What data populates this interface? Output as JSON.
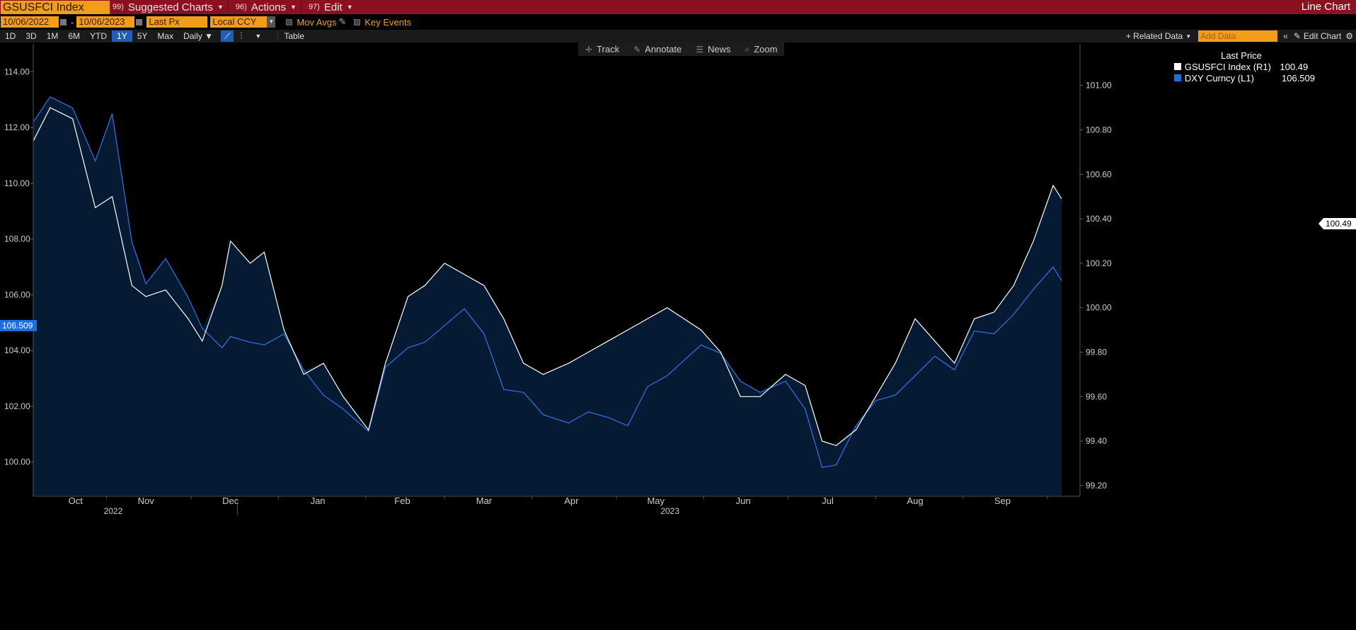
{
  "titlebar": {
    "ticker": "GSUSFCI Index",
    "menus": [
      {
        "num": "99)",
        "label": "Suggested Charts"
      },
      {
        "num": "96)",
        "label": "Actions"
      },
      {
        "num": "97)",
        "label": "Edit"
      }
    ],
    "chart_kind": "Line Chart"
  },
  "controls": {
    "start_date": "10/06/2022",
    "end_date": "10/06/2023",
    "field": "Last Px",
    "currency": "Local CCY",
    "mov_avgs": "Mov Avgs",
    "key_events": "Key Events"
  },
  "periods": [
    "1D",
    "3D",
    "1M",
    "6M",
    "YTD",
    "1Y",
    "5Y",
    "Max"
  ],
  "active_period": "1Y",
  "frequency": "Daily ▼",
  "table_label": "Table",
  "toolbar_right": {
    "related": "+ Related Data",
    "add_data_placeholder": "Add Data",
    "edit_chart": "Edit Chart"
  },
  "chart_tools": [
    "Track",
    "Annotate",
    "News",
    "Zoom"
  ],
  "legend": {
    "title": "Last Price",
    "items": [
      {
        "name": "GSUSFCI Index  (R1)",
        "value": "100.49",
        "color": "#ffffff"
      },
      {
        "name": "DXY Curncy  (L1)",
        "value": "106.509",
        "color": "#1b6ee0"
      }
    ]
  },
  "last_tags": {
    "left": "106.509",
    "right": "100.49"
  },
  "colors": {
    "fill": "#061a33",
    "dxy": "#2f74e8",
    "gsusfci": "#ffffff",
    "background": "#000000"
  },
  "chart_data": {
    "type": "line",
    "x_start": "2022-10-06",
    "x_end": "2023-10-06",
    "month_labels": [
      "Oct",
      "Nov",
      "Dec",
      "Jan",
      "Feb",
      "Mar",
      "Apr",
      "May",
      "Jun",
      "Jul",
      "Aug",
      "Sep"
    ],
    "year_labels": [
      "2022",
      "2023"
    ],
    "left_axis": {
      "series": "DXY Curncy",
      "ylim": [
        98.8,
        115.0
      ],
      "ticks": [
        "114.00",
        "112.00",
        "110.00",
        "108.00",
        "106.00",
        "104.00",
        "102.00",
        "100.00"
      ]
    },
    "right_axis": {
      "series": "GSUSFCI Index",
      "ylim": [
        99.155,
        101.187
      ],
      "ticks": [
        "101.00",
        "100.80",
        "100.60",
        "100.40",
        "100.20",
        "100.00",
        "99.80",
        "99.60",
        "99.40",
        "99.20"
      ]
    },
    "series": [
      {
        "name": "DXY Curncy (L1)",
        "axis": "left",
        "points": [
          [
            "2022-10-06",
            112.2
          ],
          [
            "2022-10-12",
            113.1
          ],
          [
            "2022-10-20",
            112.7
          ],
          [
            "2022-10-28",
            110.8
          ],
          [
            "2022-11-03",
            112.5
          ],
          [
            "2022-11-10",
            107.9
          ],
          [
            "2022-11-15",
            106.4
          ],
          [
            "2022-11-22",
            107.3
          ],
          [
            "2022-11-30",
            105.9
          ],
          [
            "2022-12-05",
            104.8
          ],
          [
            "2022-12-12",
            104.1
          ],
          [
            "2022-12-15",
            104.5
          ],
          [
            "2022-12-22",
            104.3
          ],
          [
            "2022-12-27",
            104.2
          ],
          [
            "2023-01-03",
            104.6
          ],
          [
            "2023-01-10",
            103.3
          ],
          [
            "2023-01-17",
            102.4
          ],
          [
            "2023-01-24",
            101.9
          ],
          [
            "2023-02-02",
            101.1
          ],
          [
            "2023-02-08",
            103.4
          ],
          [
            "2023-02-16",
            104.1
          ],
          [
            "2023-02-22",
            104.3
          ],
          [
            "2023-03-01",
            104.9
          ],
          [
            "2023-03-08",
            105.5
          ],
          [
            "2023-03-15",
            104.6
          ],
          [
            "2023-03-22",
            102.6
          ],
          [
            "2023-03-29",
            102.5
          ],
          [
            "2023-04-05",
            101.7
          ],
          [
            "2023-04-14",
            101.4
          ],
          [
            "2023-04-21",
            101.8
          ],
          [
            "2023-04-28",
            101.6
          ],
          [
            "2023-05-05",
            101.3
          ],
          [
            "2023-05-12",
            102.7
          ],
          [
            "2023-05-19",
            103.1
          ],
          [
            "2023-05-31",
            104.2
          ],
          [
            "2023-06-07",
            103.9
          ],
          [
            "2023-06-14",
            102.9
          ],
          [
            "2023-06-21",
            102.5
          ],
          [
            "2023-06-30",
            102.9
          ],
          [
            "2023-07-07",
            101.9
          ],
          [
            "2023-07-13",
            99.8
          ],
          [
            "2023-07-18",
            99.9
          ],
          [
            "2023-07-25",
            101.3
          ],
          [
            "2023-08-01",
            102.2
          ],
          [
            "2023-08-08",
            102.4
          ],
          [
            "2023-08-15",
            103.1
          ],
          [
            "2023-08-22",
            103.8
          ],
          [
            "2023-08-29",
            103.3
          ],
          [
            "2023-09-05",
            104.7
          ],
          [
            "2023-09-12",
            104.6
          ],
          [
            "2023-09-19",
            105.3
          ],
          [
            "2023-09-26",
            106.2
          ],
          [
            "2023-10-03",
            107.0
          ],
          [
            "2023-10-06",
            106.509
          ]
        ]
      },
      {
        "name": "GSUSFCI Index (R1)",
        "axis": "right",
        "points": [
          [
            "2022-10-06",
            100.75
          ],
          [
            "2022-10-12",
            100.9
          ],
          [
            "2022-10-20",
            100.85
          ],
          [
            "2022-10-28",
            100.45
          ],
          [
            "2022-11-03",
            100.5
          ],
          [
            "2022-11-10",
            100.1
          ],
          [
            "2022-11-15",
            100.05
          ],
          [
            "2022-11-22",
            100.08
          ],
          [
            "2022-11-30",
            99.95
          ],
          [
            "2022-12-05",
            99.85
          ],
          [
            "2022-12-12",
            100.1
          ],
          [
            "2022-12-15",
            100.3
          ],
          [
            "2022-12-22",
            100.2
          ],
          [
            "2022-12-27",
            100.25
          ],
          [
            "2023-01-03",
            99.9
          ],
          [
            "2023-01-10",
            99.7
          ],
          [
            "2023-01-17",
            99.75
          ],
          [
            "2023-01-24",
            99.6
          ],
          [
            "2023-02-02",
            99.45
          ],
          [
            "2023-02-08",
            99.75
          ],
          [
            "2023-02-16",
            100.05
          ],
          [
            "2023-02-22",
            100.1
          ],
          [
            "2023-03-01",
            100.2
          ],
          [
            "2023-03-08",
            100.15
          ],
          [
            "2023-03-15",
            100.1
          ],
          [
            "2023-03-22",
            99.95
          ],
          [
            "2023-03-29",
            99.75
          ],
          [
            "2023-04-05",
            99.7
          ],
          [
            "2023-04-14",
            99.75
          ],
          [
            "2023-04-21",
            99.8
          ],
          [
            "2023-04-28",
            99.85
          ],
          [
            "2023-05-05",
            99.9
          ],
          [
            "2023-05-12",
            99.95
          ],
          [
            "2023-05-19",
            100.0
          ],
          [
            "2023-05-31",
            99.9
          ],
          [
            "2023-06-07",
            99.8
          ],
          [
            "2023-06-14",
            99.6
          ],
          [
            "2023-06-21",
            99.6
          ],
          [
            "2023-06-30",
            99.7
          ],
          [
            "2023-07-07",
            99.65
          ],
          [
            "2023-07-13",
            99.4
          ],
          [
            "2023-07-18",
            99.38
          ],
          [
            "2023-07-25",
            99.45
          ],
          [
            "2023-08-01",
            99.6
          ],
          [
            "2023-08-08",
            99.75
          ],
          [
            "2023-08-15",
            99.95
          ],
          [
            "2023-08-22",
            99.85
          ],
          [
            "2023-08-29",
            99.75
          ],
          [
            "2023-09-05",
            99.95
          ],
          [
            "2023-09-12",
            99.98
          ],
          [
            "2023-09-19",
            100.1
          ],
          [
            "2023-09-26",
            100.3
          ],
          [
            "2023-10-03",
            100.55
          ],
          [
            "2023-10-06",
            100.49
          ]
        ]
      }
    ]
  }
}
